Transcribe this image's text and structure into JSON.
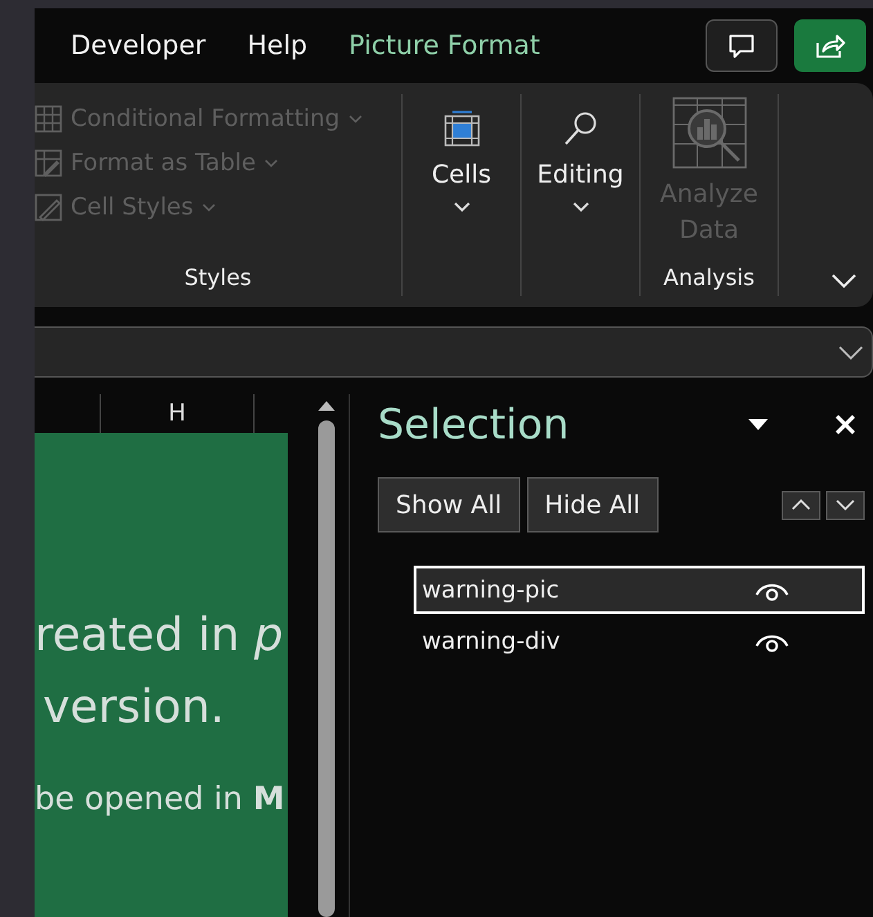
{
  "ribbon_tabs": [
    {
      "label": "Developer",
      "kind": "normal"
    },
    {
      "label": "Help",
      "kind": "normal"
    },
    {
      "label": "Picture Format",
      "kind": "contextual"
    }
  ],
  "ribbon": {
    "styles_group": {
      "label": "Styles",
      "commands": [
        {
          "label": "Conditional Formatting",
          "disabled": true
        },
        {
          "label": "Format as Table",
          "disabled": true
        },
        {
          "label": "Cell Styles",
          "disabled": true
        }
      ]
    },
    "cells_button": {
      "label": "Cells",
      "disabled": false
    },
    "editing_button": {
      "label": "Editing",
      "disabled": false
    },
    "analysis_group": {
      "label": "Analysis",
      "command": {
        "label": "Analyze Data",
        "disabled": true
      }
    }
  },
  "sheet": {
    "column_header": "H",
    "lines": [
      {
        "text": "reated in *p*",
        "kind": "large"
      },
      {
        "text": "version.",
        "kind": "large"
      },
      {
        "text": "be opened in **M**",
        "kind": "small"
      }
    ]
  },
  "selection_pane": {
    "title": "Selection",
    "buttons": [
      "Show All",
      "Hide All"
    ],
    "items": [
      {
        "name": "warning-pic",
        "selected": true,
        "visible": true
      },
      {
        "name": "warning-div",
        "selected": false,
        "visible": true
      }
    ]
  }
}
